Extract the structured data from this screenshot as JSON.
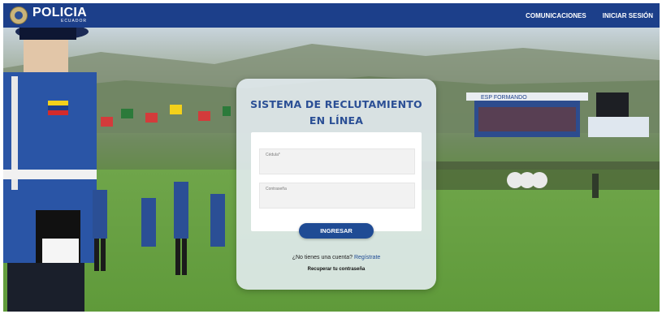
{
  "navbar": {
    "brand": "POLICIA",
    "brand_sub": "ECUADOR",
    "links": [
      "COMUNICACIONES",
      "INICIAR SESIÓN"
    ]
  },
  "login": {
    "title_line1": "SISTEMA DE RECLUTAMIENTO",
    "title_line2": "EN LÍNEA",
    "id_label": "Cédula*",
    "password_label": "Contraseña",
    "submit": "INGRESAR",
    "no_account": "¿No tienes una cuenta?",
    "register": "Regístrate",
    "recover": "Recuperar tu contraseña"
  },
  "stadium_sign": "ESP FORMANDO"
}
